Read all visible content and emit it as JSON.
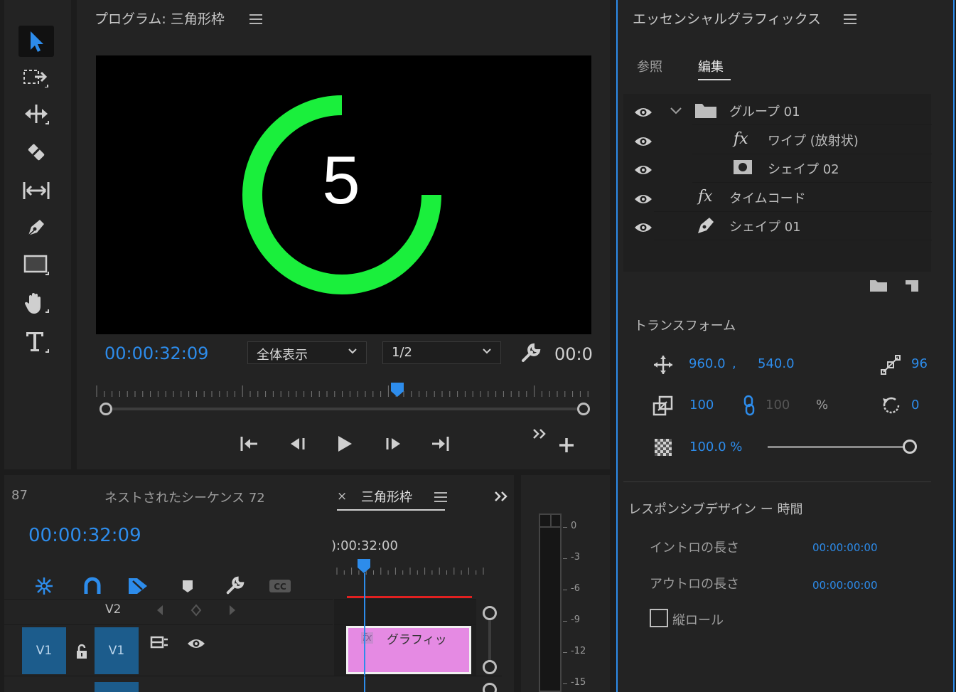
{
  "program_monitor": {
    "title": "プログラム: 三角形枠",
    "timecode": "00:00:32:09",
    "zoom": "全体表示",
    "resolution": "1/2",
    "end_timecode": "00:0",
    "preview_number": "5",
    "ring_color": "#1aef3c",
    "ring_progress_percent": 75,
    "playhead_position_percent": 61
  },
  "tools": [
    {
      "name": "selection-tool",
      "icon": "arrow-icon",
      "active": true
    },
    {
      "name": "track-select-tool",
      "icon": "track-select-icon"
    },
    {
      "name": "ripple-edit-tool",
      "icon": "ripple-edit-icon"
    },
    {
      "name": "razor-tool",
      "icon": "razor-icon"
    },
    {
      "name": "slip-tool",
      "icon": "slip-icon"
    },
    {
      "name": "pen-tool",
      "icon": "pen-icon"
    },
    {
      "name": "rectangle-tool",
      "icon": "rectangle-icon"
    },
    {
      "name": "hand-tool",
      "icon": "hand-icon"
    },
    {
      "name": "type-tool",
      "icon": "type-icon"
    }
  ],
  "timeline": {
    "left_tab_fragment": "87",
    "nested_tab": "ネストされたシーケンス 72",
    "active_tab_close": "×",
    "active_tab": "三角形枠",
    "timecode": "00:00:32:09",
    "ruler_timecode": "):00:32:00",
    "track_v2_label": "V2",
    "track_v1_source": "V1",
    "track_v1_target": "V1",
    "clip_fx": "fx",
    "clip_label": "グラフィッ",
    "clip_color": "#e58ae3"
  },
  "audio_meter": {
    "labels": [
      "0",
      "-3",
      "-6",
      "-9",
      "-12",
      "-15"
    ]
  },
  "essential_graphics": {
    "title": "エッセンシャルグラフィックス",
    "tabs": [
      "参照",
      "編集"
    ],
    "active_tab": "編集",
    "layers": [
      {
        "label": "グループ 01",
        "icon": "folder-icon",
        "fx": ""
      },
      {
        "label": "ワイプ (放射状)",
        "icon": "",
        "fx": "fx"
      },
      {
        "label": "シェイプ 02",
        "icon": "shape-mask-icon",
        "fx": ""
      },
      {
        "label": "タイムコード",
        "icon": "",
        "fx": "fx"
      },
      {
        "label": "シェイプ 01",
        "icon": "pen-icon",
        "fx": ""
      }
    ],
    "transform": {
      "heading": "トランスフォーム",
      "position_x": "960.0",
      "position_sep": ",",
      "position_y": "540.0",
      "anchor_value": "96",
      "scale_w": "100",
      "scale_h": "100",
      "scale_unit": "%",
      "rotation": "0",
      "opacity": "100.0 %",
      "opacity_percent": 100
    },
    "responsive": {
      "heading": "レスポンシブデザイン ー 時間",
      "intro_label": "イントロの長さ",
      "intro_value": "00:00:00:00",
      "outro_label": "アウトロの長さ",
      "outro_value": "00:00:00:00",
      "roll_label": "縦ロール"
    }
  }
}
